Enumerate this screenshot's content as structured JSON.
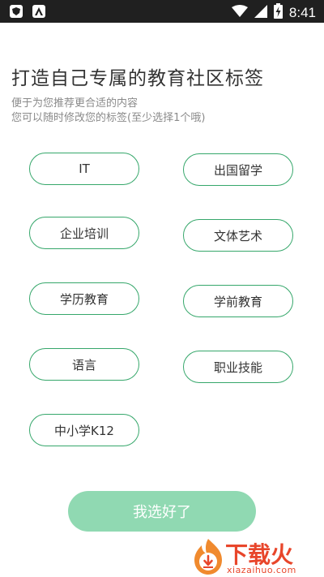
{
  "status_bar": {
    "time": "8:41",
    "left_icons": [
      "shield-app-icon",
      "a-app-icon"
    ],
    "right_icons": [
      "wifi-icon",
      "signal-icon",
      "battery-charging-icon"
    ]
  },
  "header": {
    "title": "打造自己专属的教育社区标签",
    "subtitle_line1": "便于为您推荐更合适的内容",
    "subtitle_line2": "您可以随时修改您的标签(至少选择1个哦)"
  },
  "tags": [
    {
      "label": "IT"
    },
    {
      "label": "出国留学"
    },
    {
      "label": "企业培训"
    },
    {
      "label": "文体艺术"
    },
    {
      "label": "学历教育"
    },
    {
      "label": "学前教育"
    },
    {
      "label": "语言"
    },
    {
      "label": "职业技能"
    },
    {
      "label": "中小学K12"
    }
  ],
  "confirm_button": {
    "label": "我选好了"
  },
  "watermark": {
    "text": "下载火",
    "url": "xiazaihuo.com"
  },
  "colors": {
    "accent_green": "#36a76b",
    "button_green_light": "#90d9b2",
    "status_bar": "#202020",
    "watermark_red": "#e8462b"
  }
}
